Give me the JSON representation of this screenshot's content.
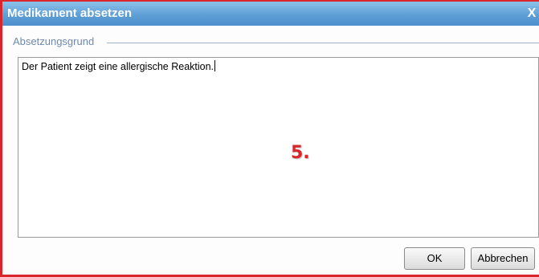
{
  "dialog": {
    "title": "Medikament absetzen",
    "close_glyph": "X"
  },
  "form": {
    "legend": "Absetzungsgrund",
    "reason_text": "Der Patient zeigt eine allergische Reaktion."
  },
  "annotation": {
    "step_label": "5."
  },
  "buttons": {
    "ok_label": "OK",
    "cancel_label": "Abbrechen"
  },
  "colors": {
    "title_bar": "#5e9fd6",
    "border_accent": "#d9262a",
    "legend_text": "#6d8aae"
  }
}
